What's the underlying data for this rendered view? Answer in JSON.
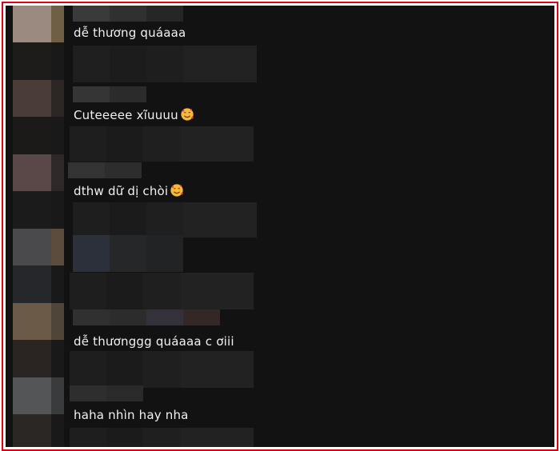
{
  "comments": [
    {
      "text": "dễ thương quáaaa",
      "emoji": false,
      "avatar_color": "#9b8a7f",
      "avatar_edge": "#6e5f45"
    },
    {
      "text": "Cuteeeee xĩuuuu",
      "emoji": true,
      "avatar_color": "#4a3c36",
      "avatar_edge": "#2c2624"
    },
    {
      "text": "dthw dữ dị chòi",
      "emoji": true,
      "avatar_color": "#5a4747",
      "avatar_edge": "#2e2828"
    },
    {
      "text": "",
      "emoji": false,
      "avatar_color": "#4a4a4c",
      "avatar_edge": "#5b4c3e"
    },
    {
      "text": "dễ thươnggg quáaaa c ơiii",
      "emoji": false,
      "avatar_color": "#6b5a47",
      "avatar_edge": "#4f4538"
    },
    {
      "text": "haha nhìn hay nha",
      "emoji": false,
      "avatar_color": "#545557",
      "avatar_edge": "#3a3b3d"
    }
  ],
  "emoji_icon": "smiling-face-with-hearts-icon"
}
